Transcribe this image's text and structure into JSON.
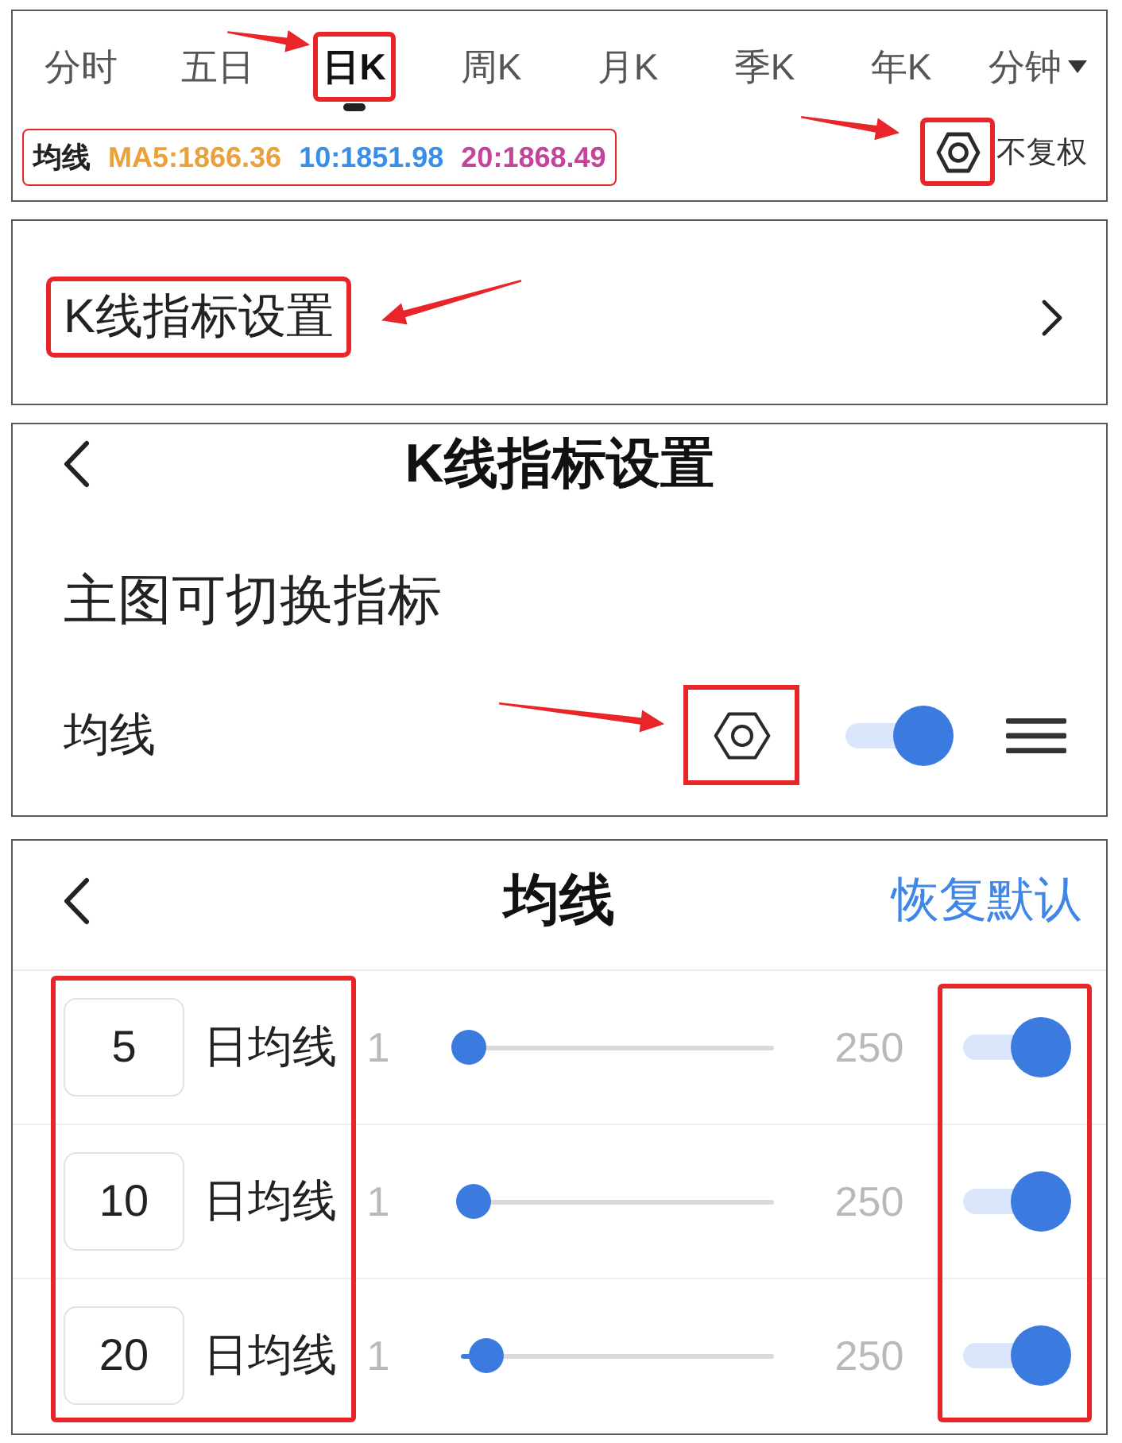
{
  "period_tabs": [
    {
      "label": "分时",
      "kind": "tab",
      "selected": false,
      "highlighted": false,
      "arrow": false
    },
    {
      "label": "五日",
      "kind": "tab",
      "selected": false,
      "highlighted": false,
      "arrow": false
    },
    {
      "label": "日K",
      "kind": "tab",
      "selected": true,
      "highlighted": true,
      "arrow": true
    },
    {
      "label": "周K",
      "kind": "tab",
      "selected": false,
      "highlighted": false,
      "arrow": false
    },
    {
      "label": "月K",
      "kind": "tab",
      "selected": false,
      "highlighted": false,
      "arrow": false
    },
    {
      "label": "季K",
      "kind": "tab",
      "selected": false,
      "highlighted": false,
      "arrow": false
    },
    {
      "label": "年K",
      "kind": "tab",
      "selected": false,
      "highlighted": false,
      "arrow": false
    },
    {
      "label": "分钟",
      "kind": "dropdown",
      "selected": false,
      "highlighted": false,
      "arrow": false
    }
  ],
  "ma_legend": {
    "title": "均线",
    "highlighted": true,
    "values": [
      {
        "text": "MA5:1866.36",
        "color": "#e9a23b"
      },
      {
        "text": "10:1851.98",
        "color": "#3b8ee6"
      },
      {
        "text": "20:1868.49",
        "color": "#c2449b"
      }
    ]
  },
  "adjust_settings": {
    "highlighted": true,
    "arrow": true
  },
  "adjust_mode": "不复权",
  "settings_entry": {
    "label": "K线指标设置",
    "highlighted": true,
    "arrow": true
  },
  "indicator_screen": {
    "title": "K线指标设置",
    "section_title": "主图可切换指标",
    "indicators": [
      {
        "name": "均线",
        "on": true,
        "settings_highlighted": true,
        "arrow": true
      }
    ]
  },
  "ma_screen": {
    "title": "均线",
    "reset": "恢复默认",
    "period_fields_highlighted": true,
    "toggles_highlighted": true,
    "lines": [
      {
        "period": "5",
        "unit": "日均线",
        "min": "1",
        "max": "250",
        "level": 0.025,
        "on": true
      },
      {
        "period": "10",
        "unit": "日均线",
        "min": "1",
        "max": "250",
        "level": 0.04,
        "on": true
      },
      {
        "period": "20",
        "unit": "日均线",
        "min": "1",
        "max": "250",
        "level": 0.08,
        "on": true
      }
    ]
  }
}
